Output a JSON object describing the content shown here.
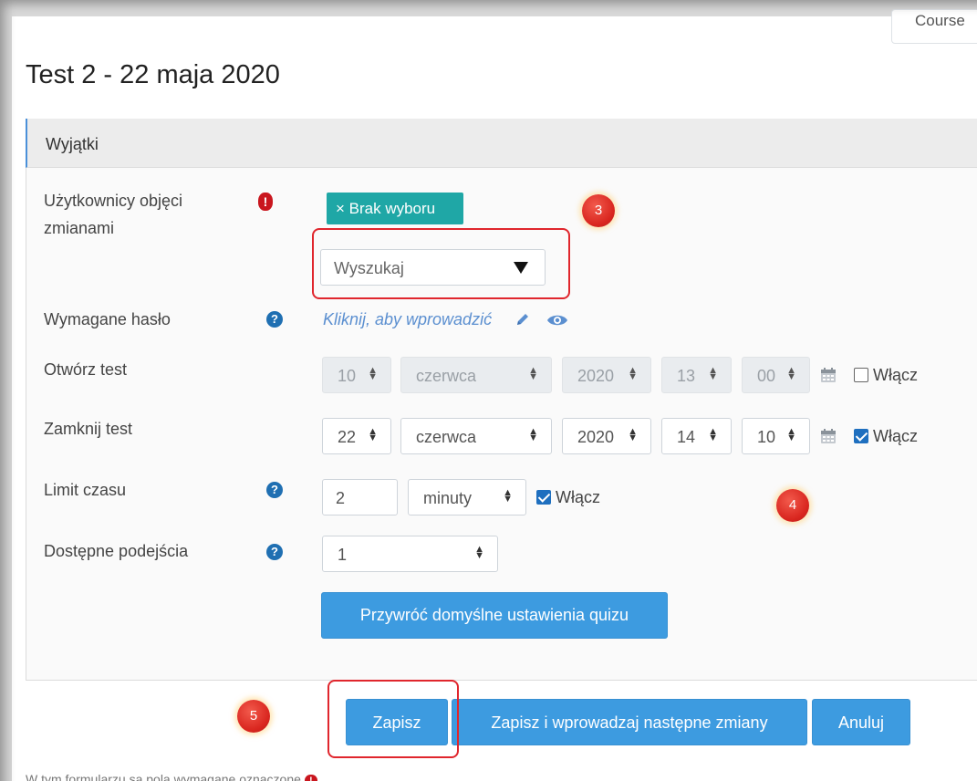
{
  "header": {
    "course_tab": "Course",
    "page_title": "Test 2 - 22 maja 2020"
  },
  "section": {
    "title": "Wyjątki"
  },
  "fields": {
    "users": {
      "label_line1": "Użytkownicy objęci",
      "label_line2": "zmianami",
      "chip": "× Brak wyboru",
      "search_placeholder": "Wyszukaj"
    },
    "password": {
      "label": "Wymagane hasło",
      "link": "Kliknij, aby wprowadzić"
    },
    "open_test": {
      "label": "Otwórz test",
      "day": "10",
      "month": "czerwca",
      "year": "2020",
      "hour": "13",
      "minute": "00",
      "enable_label": "Włącz",
      "enabled": false
    },
    "close_test": {
      "label": "Zamknij test",
      "day": "22",
      "month": "czerwca",
      "year": "2020",
      "hour": "14",
      "minute": "10",
      "enable_label": "Włącz",
      "enabled": true
    },
    "time_limit": {
      "label": "Limit czasu",
      "value": "2",
      "unit": "minuty",
      "enable_label": "Włącz",
      "enabled": true
    },
    "attempts": {
      "label": "Dostępne podejścia",
      "value": "1"
    },
    "reset_button": "Przywróć domyślne ustawienia quizu"
  },
  "buttons": {
    "save": "Zapisz",
    "save_continue": "Zapisz i wprowadzaj następne zmiany",
    "cancel": "Anuluj"
  },
  "markers": {
    "m3": "3",
    "m4": "4",
    "m5": "5"
  },
  "footnote": "W tym formularzu są pola wymagane oznaczone",
  "colors": {
    "accent": "#3d9be0",
    "chip": "#1fa7a6",
    "required": "#c9161e",
    "help": "#1f6fb2",
    "annotation": "#e0262d"
  },
  "icons": [
    "required-icon",
    "help-icon",
    "pencil-icon",
    "eye-icon",
    "calendar-icon"
  ]
}
